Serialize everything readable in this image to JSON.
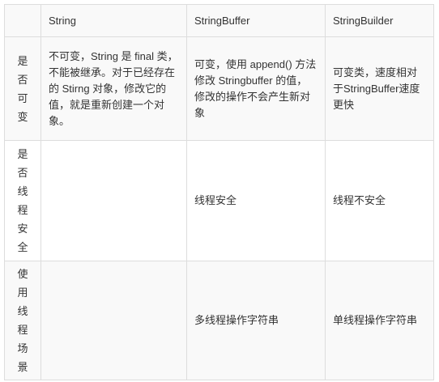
{
  "table": {
    "headers": [
      "",
      "String",
      "StringBuffer",
      "StringBuilder"
    ],
    "rows": [
      {
        "label": "是否可变",
        "cells": [
          "不可变，String 是 final 类，不能被继承。对于已经存在的 Stirng 对象，修改它的值，就是重新创建一个对象。",
          "可变，使用 append() 方法修改 Stringbuffer 的值，修改的操作不会产生新对象",
          "可变类，速度相对于StringBuffer速度更快"
        ]
      },
      {
        "label": "是否线程安全",
        "cells": [
          "",
          "线程安全",
          "线程不安全"
        ]
      },
      {
        "label": "使用线程场景",
        "cells": [
          "",
          "多线程操作字符串",
          "单线程操作字符串"
        ]
      }
    ]
  }
}
